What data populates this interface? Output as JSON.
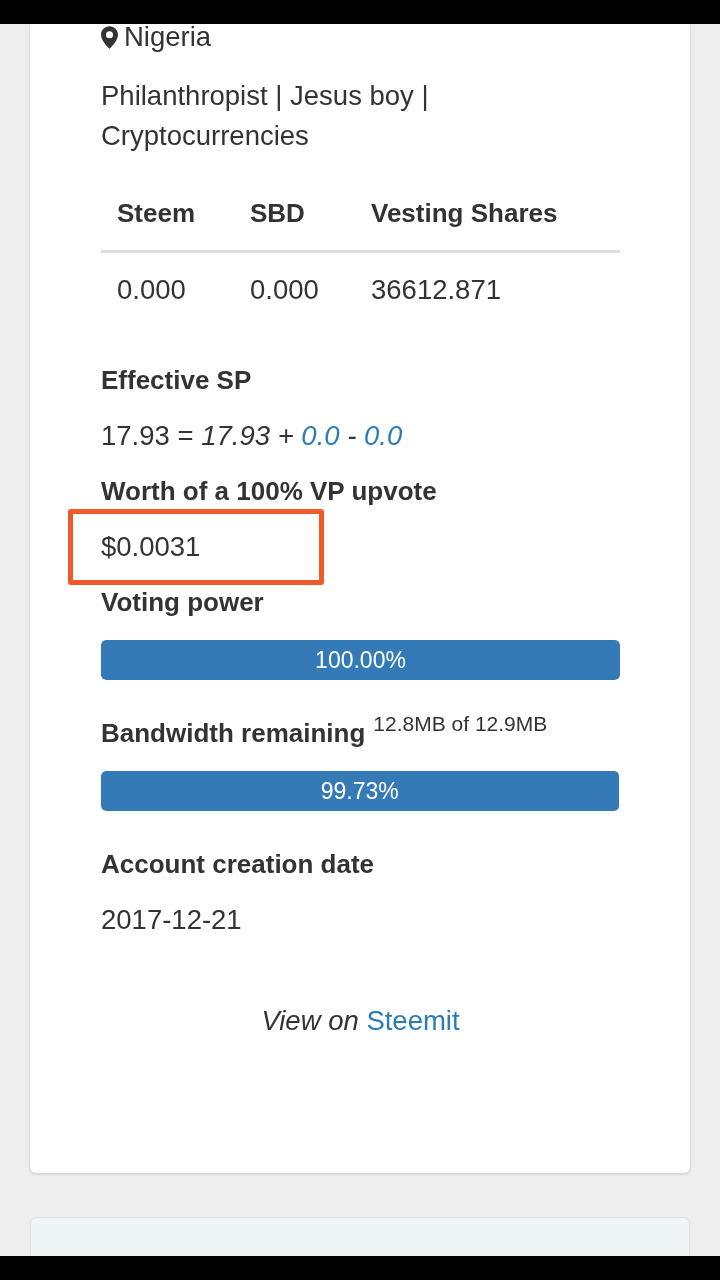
{
  "profile": {
    "location": "Nigeria",
    "bio": "Philanthropist | Jesus boy | Cryptocurrencies"
  },
  "balances": {
    "columns": [
      "Steem",
      "SBD",
      "Vesting Shares"
    ],
    "rows": [
      [
        "0.000",
        "0.000",
        "36612.871"
      ]
    ]
  },
  "sections": [
    {
      "kind": "formula",
      "heading": "Effective SP",
      "parts": [
        {
          "kind": "plain",
          "text": "17.93 = "
        },
        {
          "kind": "italic",
          "text": "17.93 + "
        },
        {
          "kind": "link",
          "text": "0.0"
        },
        {
          "kind": "italic",
          "text": " - "
        },
        {
          "kind": "link",
          "text": "0.0"
        }
      ]
    },
    {
      "kind": "value",
      "heading": "Worth of a 100% VP upvote",
      "value": "$0.0031",
      "highlighted": true
    },
    {
      "kind": "bar",
      "heading": "Voting power",
      "level": 1,
      "reading": "100.00%"
    },
    {
      "kind": "bar",
      "heading": "Bandwidth remaining",
      "note": "12.8MB of 12.9MB",
      "level": 0.9973,
      "reading": "99.73%"
    },
    {
      "kind": "value",
      "heading": "Account creation date",
      "value": "2017-12-21",
      "highlighted": false
    }
  ],
  "footer": {
    "prefix": "View on",
    "link": "Steemit"
  }
}
